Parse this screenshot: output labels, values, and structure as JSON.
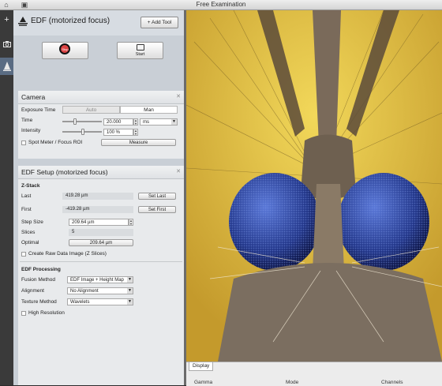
{
  "window": {
    "title": "Free Examination"
  },
  "rail": {
    "items": [
      {
        "icon": "plus-icon",
        "glyph": "+"
      },
      {
        "icon": "camera-icon",
        "glyph": "◙"
      },
      {
        "icon": "edf-icon",
        "glyph": "A"
      }
    ]
  },
  "header": {
    "title": "EDF (motorized focus)",
    "add_tool": "+ Add Tool"
  },
  "controls": {
    "stop": "Stop",
    "start": "Start"
  },
  "camera": {
    "title": "Camera",
    "exposure_time_label": "Exposure Time",
    "mode_auto": "Auto",
    "mode_man": "Man",
    "time_label": "Time",
    "time_value": "20.000",
    "time_unit": "ms",
    "intensity_label": "Intensity",
    "intensity_value": "100 %",
    "spot_meter_label": "Spot Meter / Focus ROI",
    "measure": "Measure"
  },
  "edf": {
    "title": "EDF Setup (motorized focus)",
    "zstack_label": "Z-Stack",
    "last_label": "Last",
    "last_value": "419.28 µm",
    "set_last": "Set Last",
    "first_label": "First",
    "first_value": "-419.28 µm",
    "set_first": "Set First",
    "step_label": "Step Size",
    "step_value": "209.64 µm",
    "slices_label": "Slices",
    "slices_value": "5",
    "optimal_label": "Optimal",
    "optimal_value": "209.64 µm",
    "raw_label": "Create Raw Data Image (Z Slices)",
    "processing_label": "EDF Processing",
    "fusion_label": "Fusion Method",
    "fusion_value": "EDF Image + Height Map",
    "alignment_label": "Alignment",
    "alignment_value": "No Alignment",
    "texture_label": "Texture Method",
    "texture_value": "Wavelets",
    "high_res_label": "High Resolution"
  },
  "display": {
    "tab": "Display",
    "columns": [
      "Gamma",
      "Mode",
      "Channels"
    ]
  },
  "colors": {
    "accent": "#5a6c83",
    "panel": "#c9cfd6",
    "image_bg": "#e3c23d",
    "eye": "#2a3f9a"
  }
}
